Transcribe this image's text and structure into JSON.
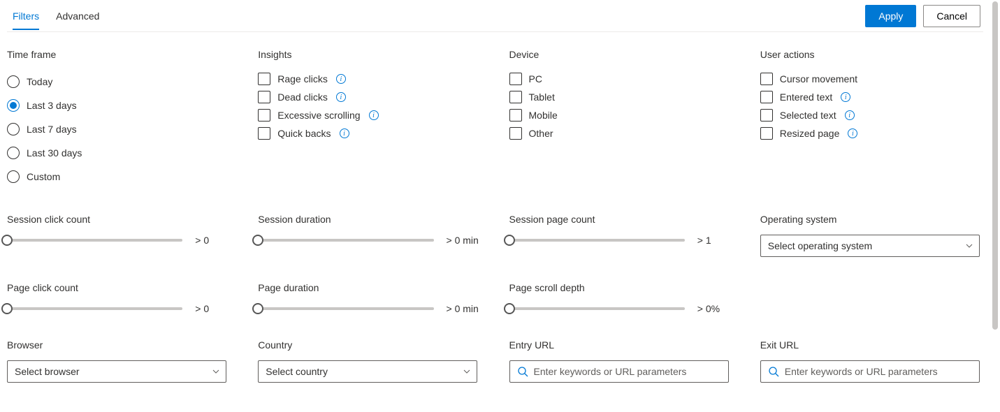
{
  "tabs": {
    "filters": "Filters",
    "advanced": "Advanced"
  },
  "buttons": {
    "apply": "Apply",
    "cancel": "Cancel"
  },
  "sections": {
    "time_frame": {
      "title": "Time frame",
      "options": {
        "today": "Today",
        "last3": "Last 3 days",
        "last7": "Last 7 days",
        "last30": "Last 30 days",
        "custom": "Custom"
      },
      "selected": "last3"
    },
    "insights": {
      "title": "Insights",
      "options": {
        "rage": "Rage clicks",
        "dead": "Dead clicks",
        "scroll": "Excessive scrolling",
        "quick": "Quick backs"
      }
    },
    "device": {
      "title": "Device",
      "options": {
        "pc": "PC",
        "tablet": "Tablet",
        "mobile": "Mobile",
        "other": "Other"
      }
    },
    "user_actions": {
      "title": "User actions",
      "options": {
        "cursor": "Cursor movement",
        "entered": "Entered text",
        "selected": "Selected text",
        "resized": "Resized page"
      }
    },
    "session_click_count": {
      "title": "Session click count",
      "value": "> 0"
    },
    "session_duration": {
      "title": "Session duration",
      "value": "> 0 min"
    },
    "session_page_count": {
      "title": "Session page count",
      "value": "> 1"
    },
    "operating_system": {
      "title": "Operating system",
      "placeholder": "Select operating system"
    },
    "page_click_count": {
      "title": "Page click count",
      "value": "> 0"
    },
    "page_duration": {
      "title": "Page duration",
      "value": "> 0 min"
    },
    "page_scroll_depth": {
      "title": "Page scroll depth",
      "value": "> 0%"
    },
    "browser": {
      "title": "Browser",
      "placeholder": "Select browser"
    },
    "country": {
      "title": "Country",
      "placeholder": "Select country"
    },
    "entry_url": {
      "title": "Entry URL",
      "placeholder": "Enter keywords or URL parameters"
    },
    "exit_url": {
      "title": "Exit URL",
      "placeholder": "Enter keywords or URL parameters"
    }
  }
}
